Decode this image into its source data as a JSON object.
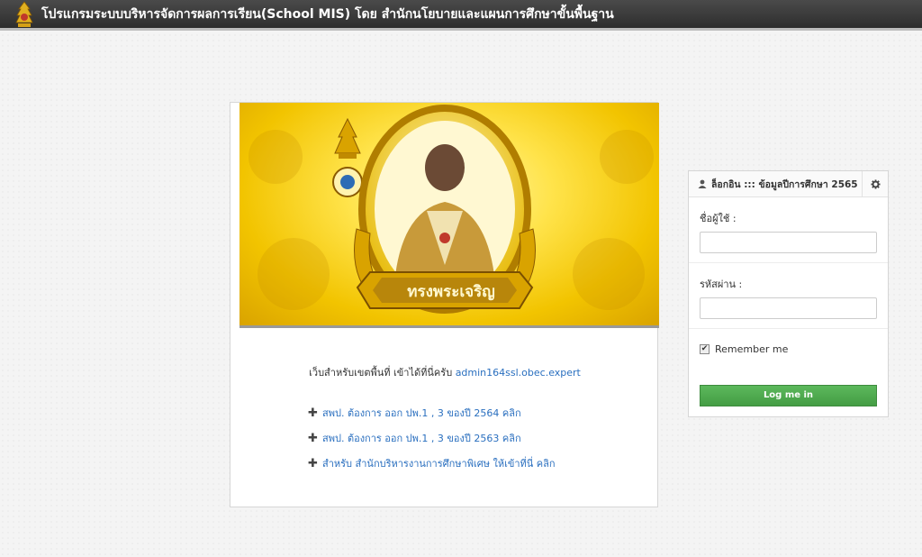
{
  "header": {
    "title": "โปรแกรมระบบบริหารจัดการผลการเรียน(School MIS) โดย สำนักนโยบายและแผนการศึกษาขั้นพื้นฐาน",
    "logo_icon": "emblem-icon"
  },
  "banner": {
    "caption": "ทรงพระเจริญ",
    "colors": {
      "gold": "#f2c400",
      "ribbon": "#8a5a00"
    }
  },
  "main": {
    "note_text": "เว็บสำหรับเขตพื้นที่ เข้าได้ที่นี่ครับ",
    "note_link": "admin164ssl.obec.expert",
    "links": [
      {
        "label": "สพป. ต้องการ ออก ปพ.1 , 3  ของปี 2564 คลิก"
      },
      {
        "label": "สพป. ต้องการ ออก ปพ.1 , 3  ของปี 2563 คลิก"
      },
      {
        "label": "สำหรับ สำนักบริหารงานการศึกษาพิเศษ ให้เข้าที่นี่ คลิก"
      }
    ]
  },
  "login": {
    "title": "ล็อกอิน ::: ข้อมูลปีการศึกษา 2565",
    "user_icon": "user-icon",
    "settings_icon": "gear-icon",
    "username_label": "ชื่อผู้ใช้ :",
    "username_value": "",
    "password_label": "รหัสผ่าน :",
    "password_value": "",
    "remember_label": "Remember me",
    "remember_checked": true,
    "submit_label": "Log me in",
    "button_color": "#5cb85c"
  }
}
